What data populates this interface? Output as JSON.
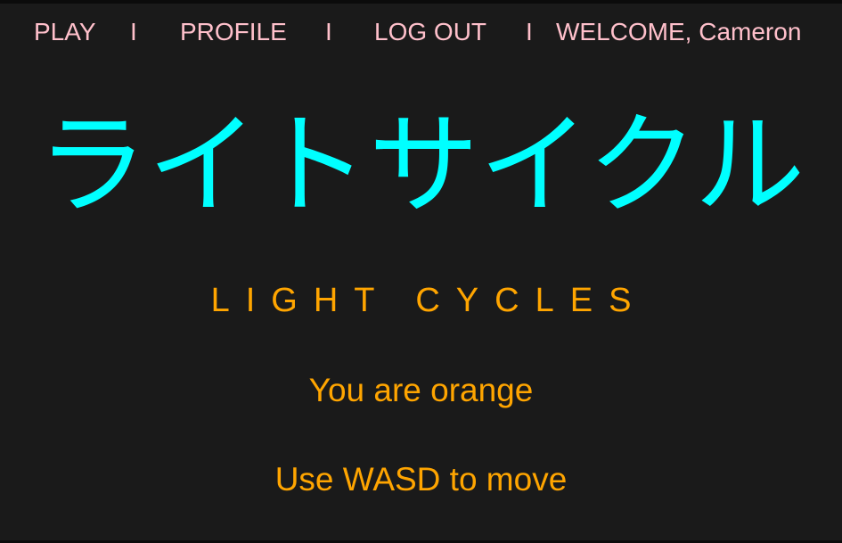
{
  "nav": {
    "play_label": "PLAY",
    "separator": "I",
    "profile_label": "PROFILE",
    "logout_label": "LOG OUT",
    "welcome_text": "WELCOME, Cameron"
  },
  "hero": {
    "title_japanese": "ライトサイクル",
    "title_english": "LIGHT CYCLES"
  },
  "instructions": {
    "player_color": "You are orange",
    "controls": "Use WASD to move"
  },
  "colors": {
    "background": "#1a1a1a",
    "nav_text": "#ffc0cb",
    "title_japanese": "#00ffff",
    "accent_orange": "#ffa500"
  }
}
